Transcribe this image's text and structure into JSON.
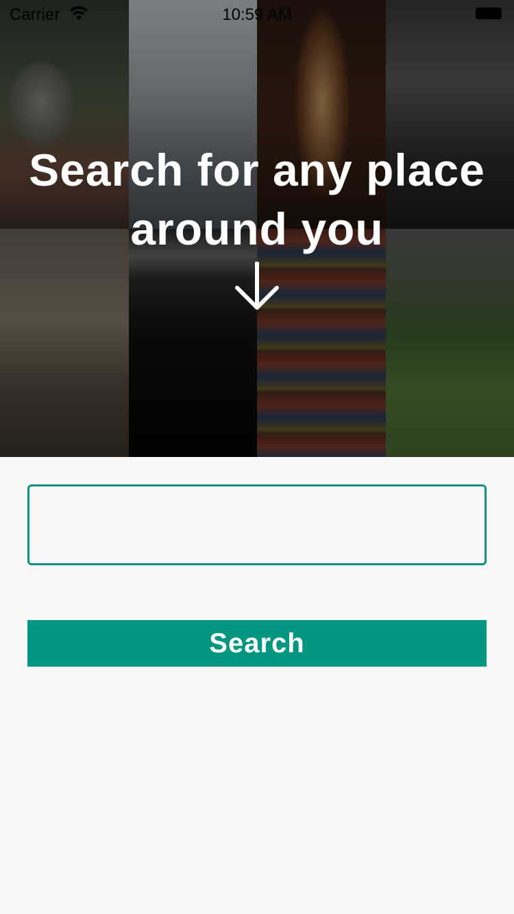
{
  "status_bar": {
    "carrier": "Carrier",
    "time": "10:59 AM",
    "icons": [
      "wifi-icon",
      "battery-icon"
    ]
  },
  "hero": {
    "title": "Search for any place around you",
    "arrow_icon": "down-arrow-icon",
    "tiles": [
      "money",
      "hospital",
      "hallway",
      "boxing-gym",
      "clothing-store",
      "cinema",
      "library",
      "park"
    ]
  },
  "search": {
    "value": "",
    "placeholder": "",
    "button_label": "Search"
  },
  "colors": {
    "accent": "#00967f",
    "input_border": "#0e9180",
    "background": "#f8f8f8"
  }
}
